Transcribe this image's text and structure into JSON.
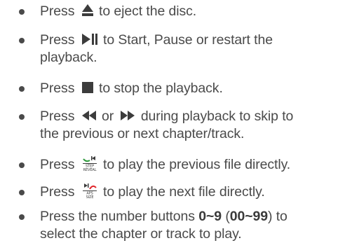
{
  "items": [
    {
      "pre": "Press",
      "icon": "eject-icon",
      "post": "to eject the disc."
    },
    {
      "pre": "Press",
      "icon": "play-pause-icon",
      "post": "to Start, Pause or restart the",
      "line2": "playback."
    },
    {
      "pre": "Press",
      "icon": "stop-icon",
      "post": "to stop the playback."
    },
    {
      "pre": "Press",
      "icon": "skip-back-icon",
      "mid": "or",
      "icon2": "skip-forward-icon",
      "post": "during playback to skip to",
      "line2": "the previous or next chapter/track."
    },
    {
      "pre": "Press",
      "icon": "step-reveal-previous-icon",
      "icon_label_1": "STEP",
      "icon_label_2": "REVEAL",
      "post": "to play the previous file directly."
    },
    {
      "pre": "Press",
      "icon": "aps-size-next-icon",
      "icon_label_1": "APS",
      "icon_label_2": "SIZE",
      "post": "to play the next file directly."
    },
    {
      "pre": "Press the number buttons",
      "bold1": "0~9",
      "paren_open": "(",
      "bold2": "00~99",
      "paren_close": ") to",
      "line2": "select the chapter or track to play."
    }
  ],
  "colors": {
    "text": "#4a4a4a",
    "icon_accent": "#e0262b",
    "icon_green": "#2e9a3c"
  }
}
